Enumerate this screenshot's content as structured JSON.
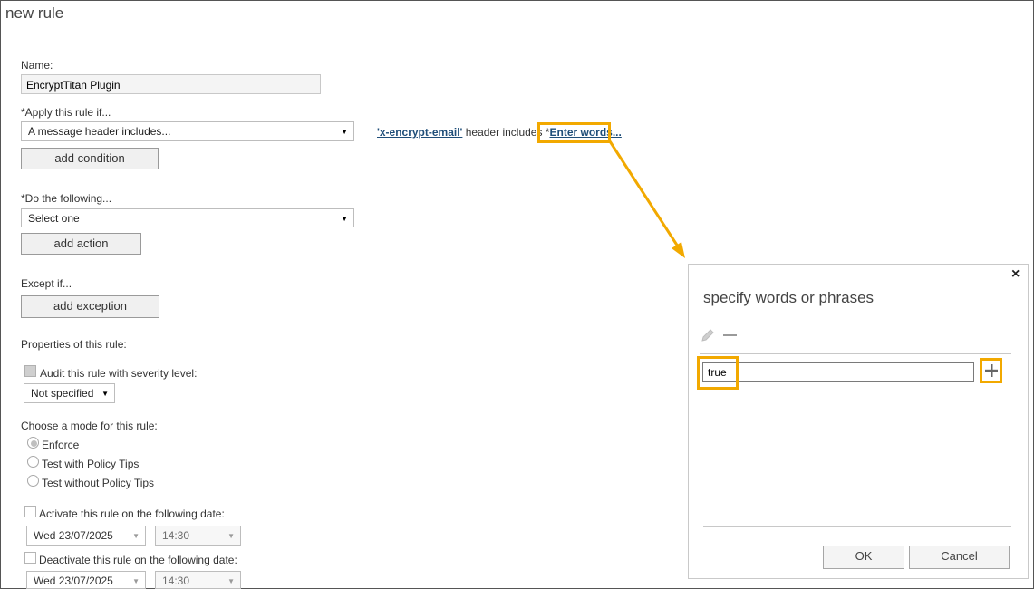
{
  "page": {
    "title": "new rule"
  },
  "form": {
    "name_label": "Name:",
    "name_value": "EncryptTitan Plugin",
    "apply_label": "*Apply this rule if...",
    "apply_select": "A message header includes...",
    "condition_link_header": "'x-encrypt-email'",
    "condition_text": " header includes ",
    "condition_asterisk": "*",
    "condition_link_words": "Enter words...",
    "add_condition": "add condition",
    "do_label": "*Do the following...",
    "do_select": "Select one",
    "add_action": "add action",
    "except_label": "Except if...",
    "add_exception": "add exception",
    "properties_label": "Properties of this rule:",
    "audit_label": "Audit this rule with severity level:",
    "severity_select": "Not specified",
    "mode_label": "Choose a mode for this rule:",
    "mode_enforce": "Enforce",
    "mode_test_tips": "Test with Policy Tips",
    "mode_test_no_tips": "Test without Policy Tips",
    "activate_label": "Activate this rule on the following date:",
    "activate_date": "Wed 23/07/2025",
    "activate_time": "14:30",
    "deactivate_label": "Deactivate this rule on the following date:",
    "deactivate_date": "Wed 23/07/2025",
    "deactivate_time": "14:30"
  },
  "dialog": {
    "close_glyph": "×",
    "title": "specify words or phrases",
    "input_value": "true",
    "ok": "OK",
    "cancel": "Cancel"
  },
  "colors": {
    "annotation": "#f2a900",
    "link": "#1f4e79"
  },
  "icons": [
    "pencil-icon",
    "minus-icon",
    "plus-icon",
    "close-icon",
    "chevron-down-icon",
    "checkbox-icon",
    "radio-icon"
  ]
}
